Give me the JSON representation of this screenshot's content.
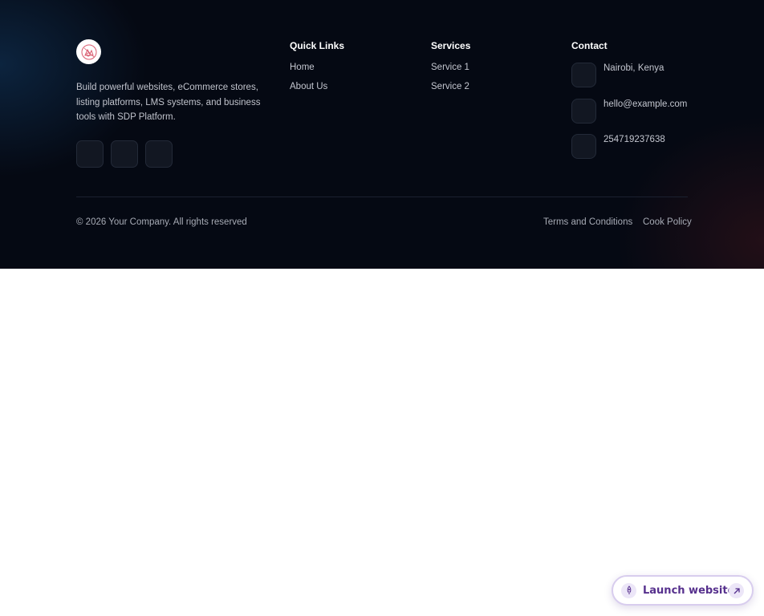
{
  "brand": {
    "logo_icon": "brand-logo-icon",
    "description": "Build powerful websites, eCommerce stores, listing platforms, LMS systems, and business tools with SDP Platform."
  },
  "social": {
    "icons": [
      "social-icon-1",
      "social-icon-2",
      "social-icon-3"
    ]
  },
  "quick_links": {
    "title": "Quick Links",
    "items": [
      {
        "label": "Home"
      },
      {
        "label": "About Us"
      }
    ]
  },
  "services": {
    "title": "Services",
    "items": [
      {
        "label": "Service 1"
      },
      {
        "label": "Service 2"
      }
    ]
  },
  "contact": {
    "title": "Contact",
    "items": [
      {
        "icon": "location-icon",
        "text": "Nairobi, Kenya"
      },
      {
        "icon": "mail-icon",
        "text": "hello@example.com"
      },
      {
        "icon": "phone-icon",
        "text": "254719237638"
      }
    ]
  },
  "bottom_bar": {
    "copyright": "© 2026 Your Company. All rights reserved",
    "links": [
      {
        "label": "Terms and Conditions"
      },
      {
        "label": "Cook Policy"
      }
    ]
  },
  "launch_button": {
    "label": "Launch website",
    "icon": "rocket-icon",
    "arrow_icon": "arrow-up-right-icon"
  },
  "colors": {
    "footer_background": "#050913",
    "accent_purple": "#56308d",
    "text_light": "#c3c6cf",
    "heading_white": "#ffffff"
  }
}
